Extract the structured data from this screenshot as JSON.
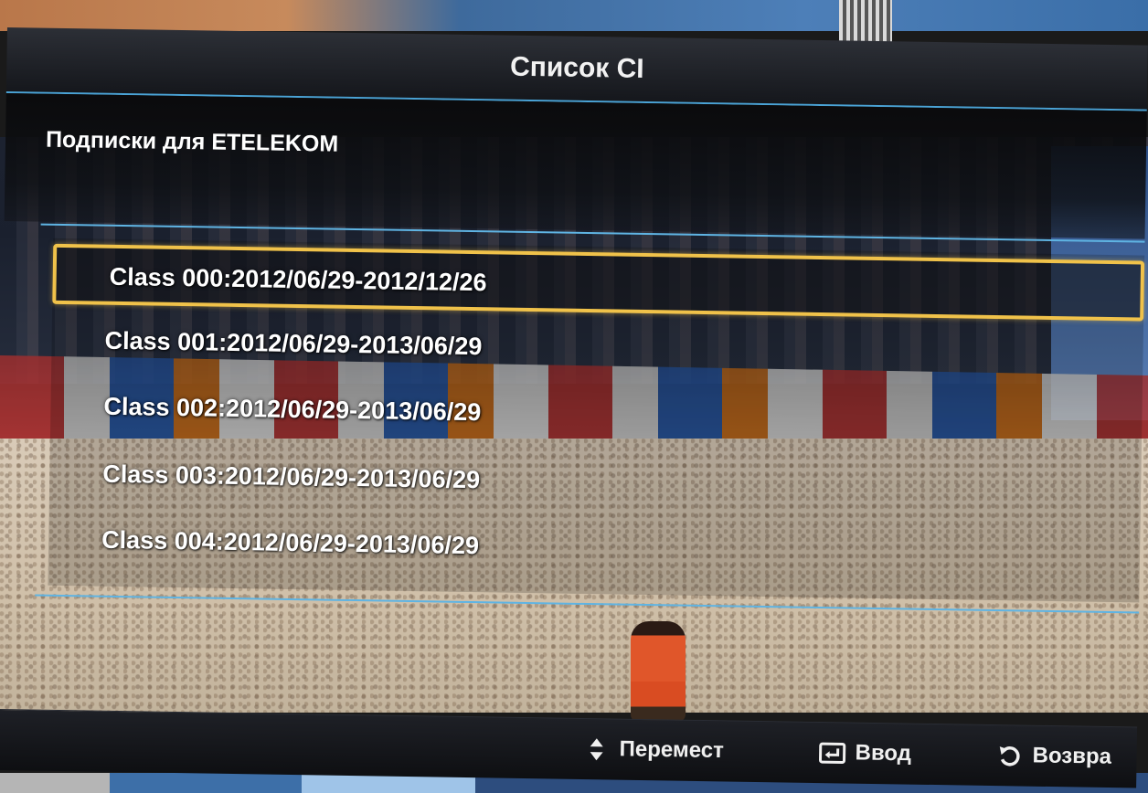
{
  "dialog": {
    "title": "Список CI",
    "subtitle": "Подписки для ETELEKOM"
  },
  "subscriptions": [
    {
      "label": "Class 000:2012/06/29-2012/12/26",
      "selected": true
    },
    {
      "label": "Class 001:2012/06/29-2013/06/29",
      "selected": false
    },
    {
      "label": "Class 002:2012/06/29-2013/06/29",
      "selected": false
    },
    {
      "label": "Class 003:2012/06/29-2013/06/29",
      "selected": false
    },
    {
      "label": "Class 004:2012/06/29-2013/06/29",
      "selected": false
    }
  ],
  "footer": {
    "move": {
      "label": "Перемест",
      "icon": "up-down-arrows-icon"
    },
    "enter": {
      "label": "Ввод",
      "icon": "enter-icon"
    },
    "return": {
      "label": "Возвра",
      "icon": "return-icon"
    }
  },
  "colors": {
    "highlight": "#f0c24a",
    "separator": "#5fb4e3",
    "text": "#ffffff"
  }
}
